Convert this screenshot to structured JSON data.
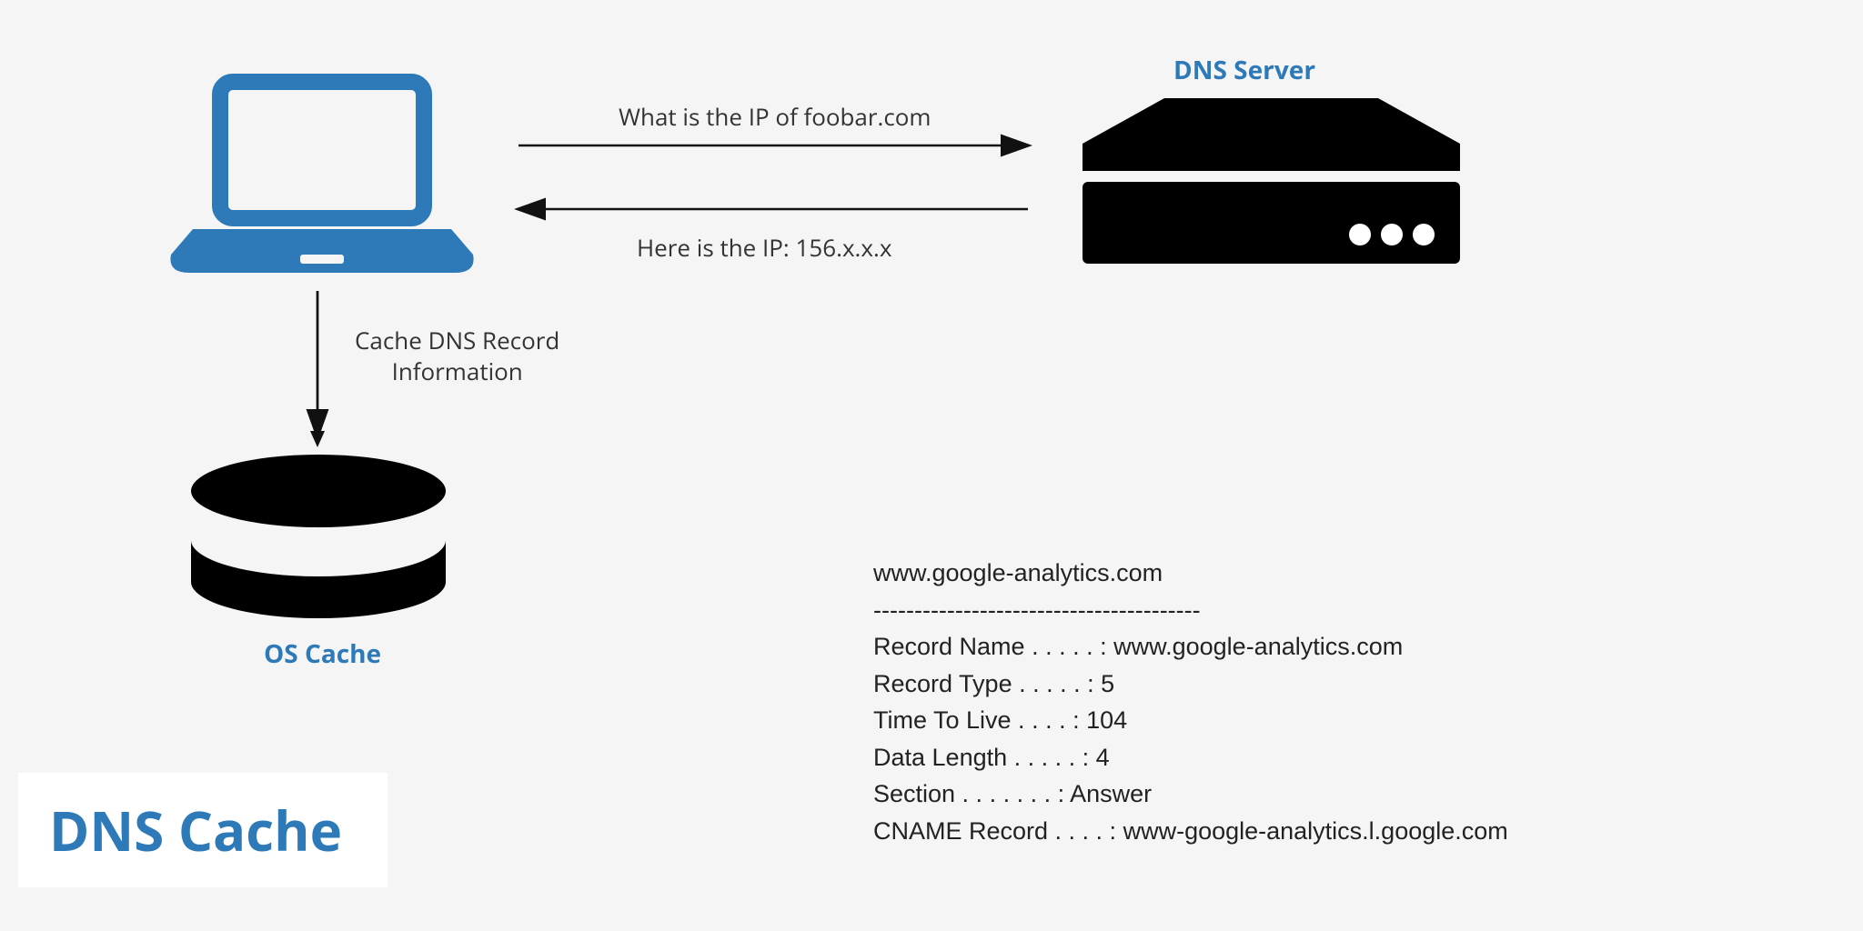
{
  "title": "DNS Cache",
  "labels": {
    "dns_server": "DNS Server",
    "os_cache": "OS Cache",
    "request": "What is the IP of foobar.com",
    "response": "Here is the IP: 156.x.x.x",
    "cache_line1": "Cache DNS Record",
    "cache_line2": "Information"
  },
  "record": {
    "host": "www.google-analytics.com",
    "divider": "----------------------------------------",
    "record_name_label": "Record Name . . . . . :",
    "record_name_value": "www.google-analytics.com",
    "record_type_label": "Record Type . . . . . :",
    "record_type_value": "5",
    "ttl_label": "Time To Live  . . . . :",
    "ttl_value": "104",
    "data_length_label": "Data Length . . . . . :",
    "data_length_value": "4",
    "section_label": "Section . . . . . . . :",
    "section_value": "Answer",
    "cname_label": "CNAME Record  . . . . :",
    "cname_value": "www-google-analytics.l.google.com"
  },
  "colors": {
    "accent": "#2e7ab8",
    "text": "#333333",
    "bg": "#f5f5f5"
  }
}
